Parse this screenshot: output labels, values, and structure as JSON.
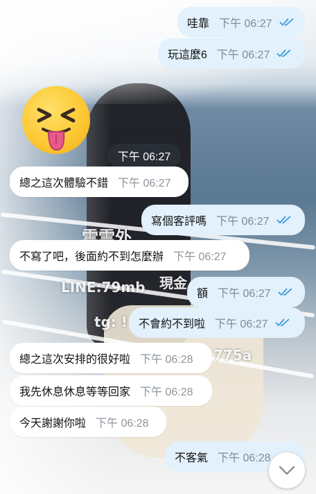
{
  "colors": {
    "outgoing_bubble": "#e2f1fc",
    "incoming_bubble": "#ffffff",
    "read_ticks": "#3a9bd8"
  },
  "background": {
    "watermark_line1": "雲雲外",
    "watermark_line2": "LINE:79mb",
    "watermark_line3": "tg: !",
    "watermark_side": "現金",
    "watermark_code": "775a"
  },
  "messages": [
    {
      "dir": "out",
      "text": "哇靠",
      "time": "下午 06:27",
      "read": true
    },
    {
      "dir": "out",
      "text": "玩這麼6",
      "time": "下午 06:27",
      "read": true
    },
    {
      "dir": "sticker",
      "icon": "tongue-out-face-emoji",
      "time": "下午 06:27"
    },
    {
      "dir": "in",
      "text": "總之這次體驗不錯",
      "time": "下午 06:27"
    },
    {
      "dir": "out",
      "text": "寫個客評嗎",
      "time": "下午 06:27",
      "read": true
    },
    {
      "dir": "in",
      "text": "不寫了吧，後面約不到怎麼辦",
      "time": "下午 06:27"
    },
    {
      "dir": "out",
      "text": "額",
      "time": "下午 06:27",
      "read": true
    },
    {
      "dir": "out",
      "text": "不會約不到啦",
      "time": "下午 06:27",
      "read": true
    },
    {
      "dir": "in",
      "text": "總之這次安排的很好啦",
      "time": "下午 06:28"
    },
    {
      "dir": "in",
      "text": "我先休息休息等等回家",
      "time": "下午 06:28"
    },
    {
      "dir": "in",
      "text": "今天謝謝你啦",
      "time": "下午 06:28"
    },
    {
      "dir": "out",
      "text": "不客氣",
      "time": "下午 06:28",
      "read": true
    }
  ],
  "scroll_button_icon": "chevron-down-icon"
}
